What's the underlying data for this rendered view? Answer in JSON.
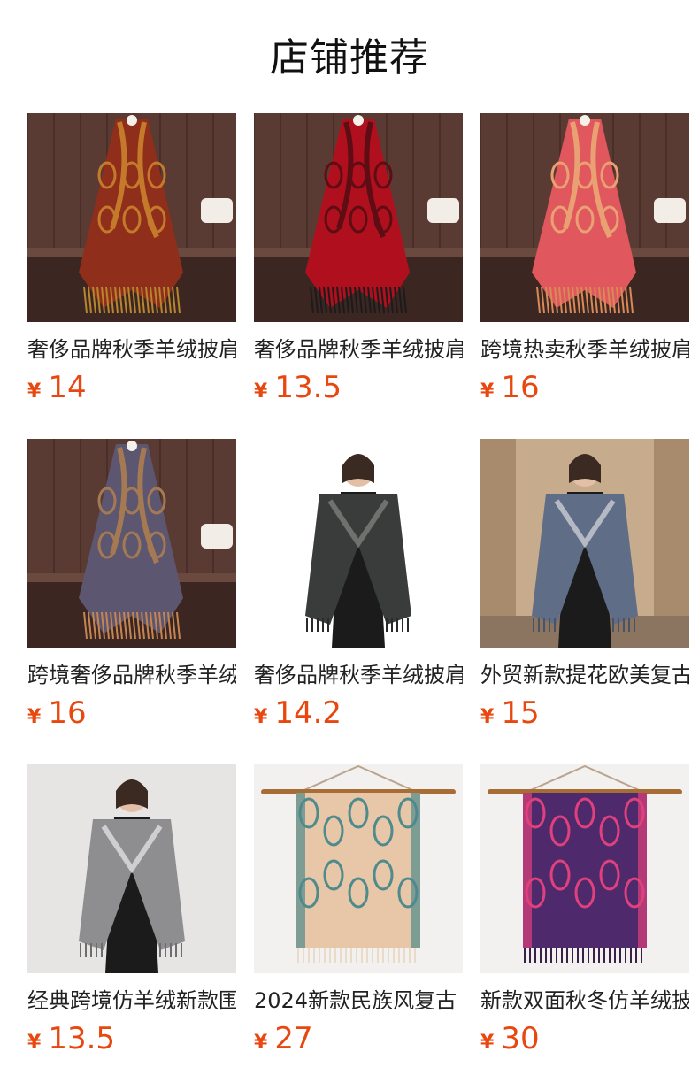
{
  "section": {
    "title": "店铺推荐"
  },
  "products": [
    {
      "name": "奢侈品牌秋季羊绒披肩",
      "currency": "¥",
      "price": "14",
      "image": "red-paisley-shawl-photo",
      "colors": {
        "wall": "#5a3b33",
        "floor": "#3b2622",
        "main": "#8f2e1a",
        "accent": "#c47a2a",
        "fringe": "#b8862e"
      }
    },
    {
      "name": "奢侈品牌秋季羊绒披肩",
      "currency": "¥",
      "price": "13.5",
      "image": "crimson-rose-shawl-photo",
      "colors": {
        "wall": "#5a3b33",
        "floor": "#3b2622",
        "main": "#b0101e",
        "accent": "#5e0d14",
        "fringe": "#1b1b1b"
      }
    },
    {
      "name": "跨境热卖秋季羊绒披肩",
      "currency": "¥",
      "price": "16",
      "image": "coral-paisley-shawl-photo",
      "colors": {
        "wall": "#5a3b33",
        "floor": "#3b2622",
        "main": "#e0575d",
        "accent": "#e9a073",
        "fringe": "#d88a58"
      }
    },
    {
      "name": "跨境奢侈品牌秋季羊绒",
      "currency": "¥",
      "price": "16",
      "image": "purple-paisley-shawl-photo",
      "colors": {
        "wall": "#5a3b33",
        "floor": "#3b2622",
        "main": "#5d5670",
        "accent": "#a57a52",
        "fringe": "#c48552"
      }
    },
    {
      "name": "奢侈品牌秋季羊绒披肩",
      "currency": "¥",
      "price": "14.2",
      "image": "model-black-shawl-photo",
      "colors": {
        "wall": "#ffffff",
        "floor": "#ffffff",
        "main": "#3a3c3b",
        "accent": "#6f716f",
        "fringe": "#2a2a2a"
      }
    },
    {
      "name": "外贸新款提花欧美复古",
      "currency": "¥",
      "price": "15",
      "image": "model-gray-paisley-shawl-photo",
      "colors": {
        "wall": "#c7ab8d",
        "floor": "#8c7560",
        "main": "#5f6d86",
        "accent": "#b5b9c4",
        "fringe": "#4a5366"
      }
    },
    {
      "name": "经典跨境仿羊绒新款围巾",
      "currency": "¥",
      "price": "13.5",
      "image": "model-silver-scarf-photo",
      "colors": {
        "wall": "#e7e5e4",
        "floor": "#d9d6d3",
        "main": "#8e8e90",
        "accent": "#cfcfd0",
        "fringe": "#6d6d6f"
      }
    },
    {
      "name": "2024新款民族风复古",
      "currency": "¥",
      "price": "27",
      "image": "hanging-beige-paisley-shawl-photo",
      "colors": {
        "wall": "#f3f1ef",
        "floor": "#f3f1ef",
        "main": "#e7c7a8",
        "accent": "#4f8a8c",
        "fringe": "#eadac8"
      }
    },
    {
      "name": "新款双面秋冬仿羊绒披肩",
      "currency": "¥",
      "price": "30",
      "image": "hanging-magenta-paisley-shawl-photo",
      "colors": {
        "wall": "#f3f1ef",
        "floor": "#f3f1ef",
        "main": "#4e2a6c",
        "accent": "#e0417c",
        "fringe": "#3a2047"
      }
    }
  ]
}
